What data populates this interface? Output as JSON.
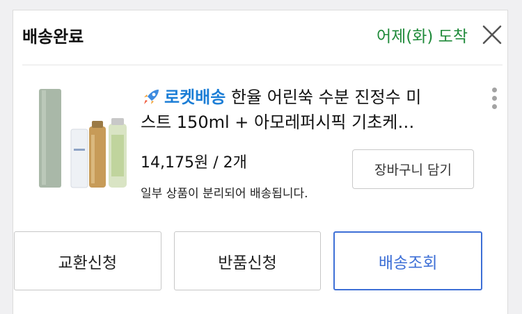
{
  "order": {
    "status_title": "배송완료",
    "arrival_text": "어제(화) 도착"
  },
  "product": {
    "badge_label": "로켓배송",
    "name_line1": " 한율 어린쑥 수분 진정수 미",
    "name_line2": "스트 150ml + 아모레퍼시픽 기초케…",
    "price_qty": "14,175원 / 2개",
    "split_note": "일부 상품이 분리되어 배송됩니다.",
    "cart_button_label": "장바구니 담기"
  },
  "actions": {
    "exchange_label": "교환신청",
    "return_label": "반품신청",
    "track_label": "배송조회"
  },
  "colors": {
    "arrival_green": "#1f8a3a",
    "rocket_blue": "#1c7ed6",
    "primary_button_blue": "#3d6fd6"
  },
  "icons": {
    "close": "close-icon",
    "rocket": "rocket-icon",
    "more": "more-vertical-icon"
  }
}
